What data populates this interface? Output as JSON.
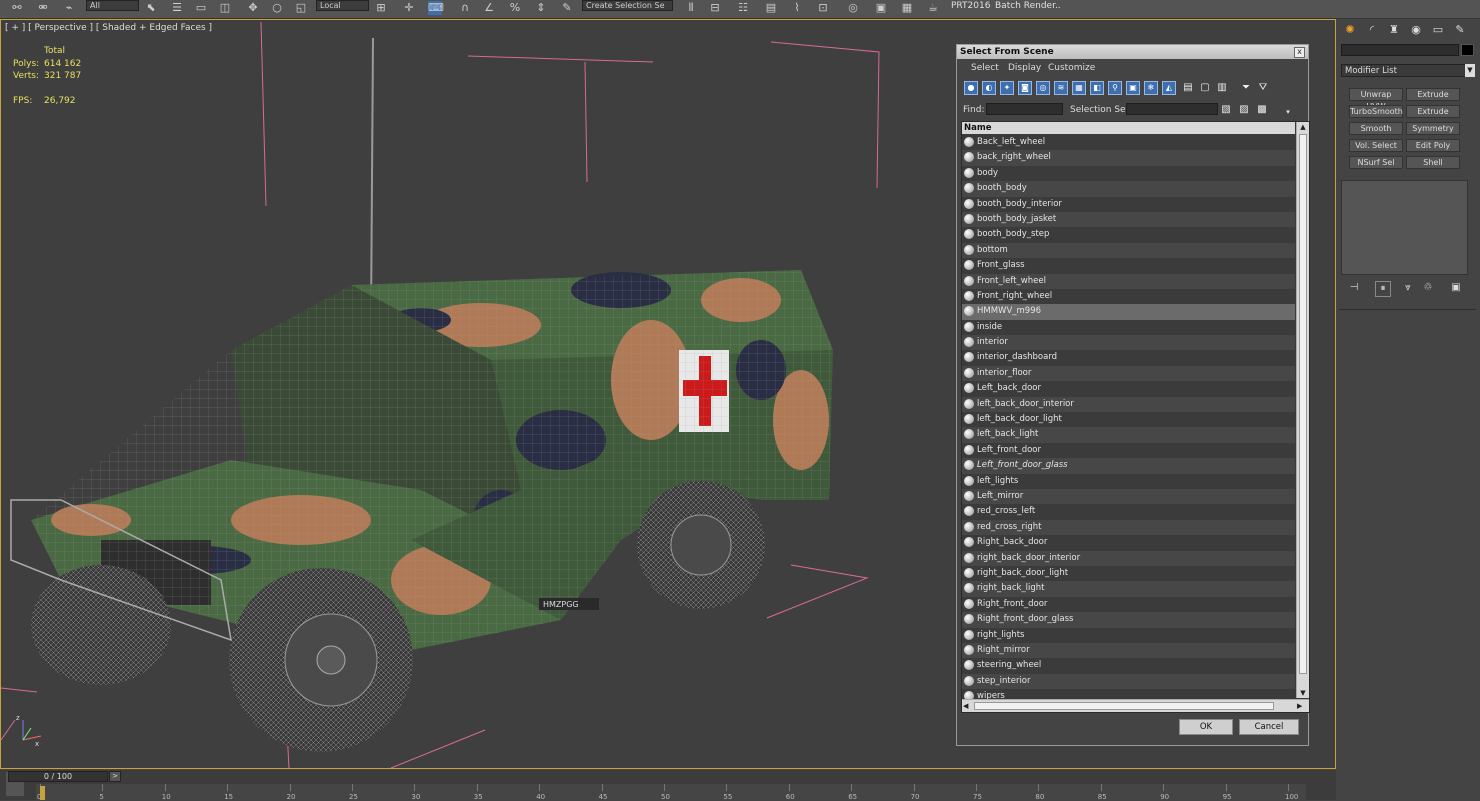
{
  "toolbar": {
    "left_drop": "All",
    "coord_drop": "Local",
    "selection_set": "Create Selection Se",
    "prt_label": "PRT2016",
    "batch_render": "Batch Render.."
  },
  "viewport": {
    "label": "[ + ] [ Perspective ] [ Shaded + Edged Faces ]",
    "stats": {
      "total_label": "Total",
      "polys_label": "Polys:",
      "polys_value": "614 162",
      "verts_label": "Verts:",
      "verts_value": "321 787",
      "fps_label": "FPS:",
      "fps_value": "26,792"
    },
    "plate": "HMZPGG",
    "axis_x": "x",
    "axis_z": "z"
  },
  "dialog": {
    "title": "Select From Scene",
    "close": "x",
    "menu": [
      "Select",
      "Display",
      "Customize"
    ],
    "find_label": "Find:",
    "selset_label": "Selection Set:",
    "col_name": "Name",
    "objects": [
      {
        "name": "Back_left_wheel"
      },
      {
        "name": "back_right_wheel"
      },
      {
        "name": "body"
      },
      {
        "name": "booth_body"
      },
      {
        "name": "booth_body_interior"
      },
      {
        "name": "booth_body_jasket"
      },
      {
        "name": "booth_body_step"
      },
      {
        "name": "bottom"
      },
      {
        "name": "Front_glass"
      },
      {
        "name": "Front_left_wheel"
      },
      {
        "name": "Front_right_wheel"
      },
      {
        "name": "HMMWV_m996"
      },
      {
        "name": "inside"
      },
      {
        "name": "interior"
      },
      {
        "name": "interior_dashboard"
      },
      {
        "name": "interior_floor"
      },
      {
        "name": "Left_back_door"
      },
      {
        "name": "left_back_door_interior"
      },
      {
        "name": "left_back_door_light"
      },
      {
        "name": "left_back_light"
      },
      {
        "name": "Left_front_door"
      },
      {
        "name": "Left_front_door_glass"
      },
      {
        "name": "left_lights"
      },
      {
        "name": "Left_mirror"
      },
      {
        "name": "red_cross_left"
      },
      {
        "name": "red_cross_right"
      },
      {
        "name": "Right_back_door"
      },
      {
        "name": "right_back_door_interior"
      },
      {
        "name": "right_back_door_light"
      },
      {
        "name": "right_back_light"
      },
      {
        "name": "Right_front_door"
      },
      {
        "name": "Right_front_door_glass"
      },
      {
        "name": "right_lights"
      },
      {
        "name": "Right_mirror"
      },
      {
        "name": "steering_wheel"
      },
      {
        "name": "step_interior"
      },
      {
        "name": "wipers"
      }
    ],
    "ok": "OK",
    "cancel": "Cancel"
  },
  "command_panel": {
    "modifier_list": "Modifier List",
    "buttons": [
      "Unwrap UVW",
      "Extrude",
      "TurboSmooth",
      "Extrude",
      "Smooth",
      "Symmetry",
      "Vol. Select",
      "Edit Poly",
      "NSurf Sel",
      "Shell"
    ]
  },
  "timeline": {
    "frame": "0 / 100",
    "ticks": [
      "0",
      "5",
      "10",
      "15",
      "20",
      "25",
      "30",
      "35",
      "40",
      "45",
      "50",
      "55",
      "60",
      "65",
      "70",
      "75",
      "80",
      "85",
      "90",
      "95",
      "100"
    ]
  },
  "colors": {
    "viewport_border": "#c8a23a",
    "stats_text": "#e8e060",
    "box_lines": "#d86a9a",
    "dialog_title": "#cfcfcf"
  }
}
